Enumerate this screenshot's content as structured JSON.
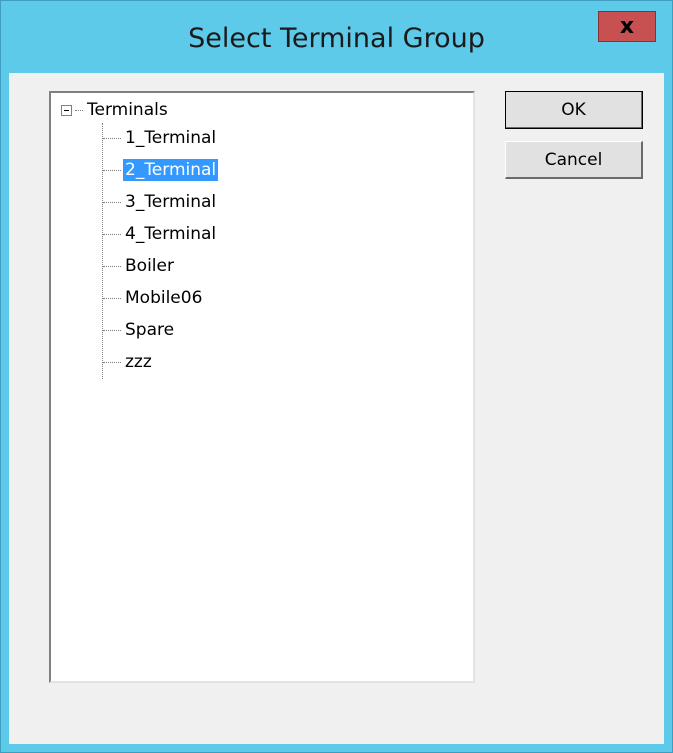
{
  "window": {
    "title": "Select Terminal Group",
    "close_label": "x"
  },
  "tree": {
    "root": {
      "label": "Terminals",
      "expanded": true
    },
    "items": [
      {
        "label": "1_Terminal",
        "selected": false
      },
      {
        "label": "2_Terminal",
        "selected": true
      },
      {
        "label": "3_Terminal",
        "selected": false
      },
      {
        "label": "4_Terminal",
        "selected": false
      },
      {
        "label": "Boiler",
        "selected": false
      },
      {
        "label": "Mobile06",
        "selected": false
      },
      {
        "label": "Spare",
        "selected": false
      },
      {
        "label": "zzz",
        "selected": false
      }
    ]
  },
  "buttons": {
    "ok_label": "OK",
    "cancel_label": "Cancel"
  },
  "colors": {
    "titlebar": "#5dcaea",
    "selection": "#3399ff",
    "close_button": "#c75050"
  }
}
